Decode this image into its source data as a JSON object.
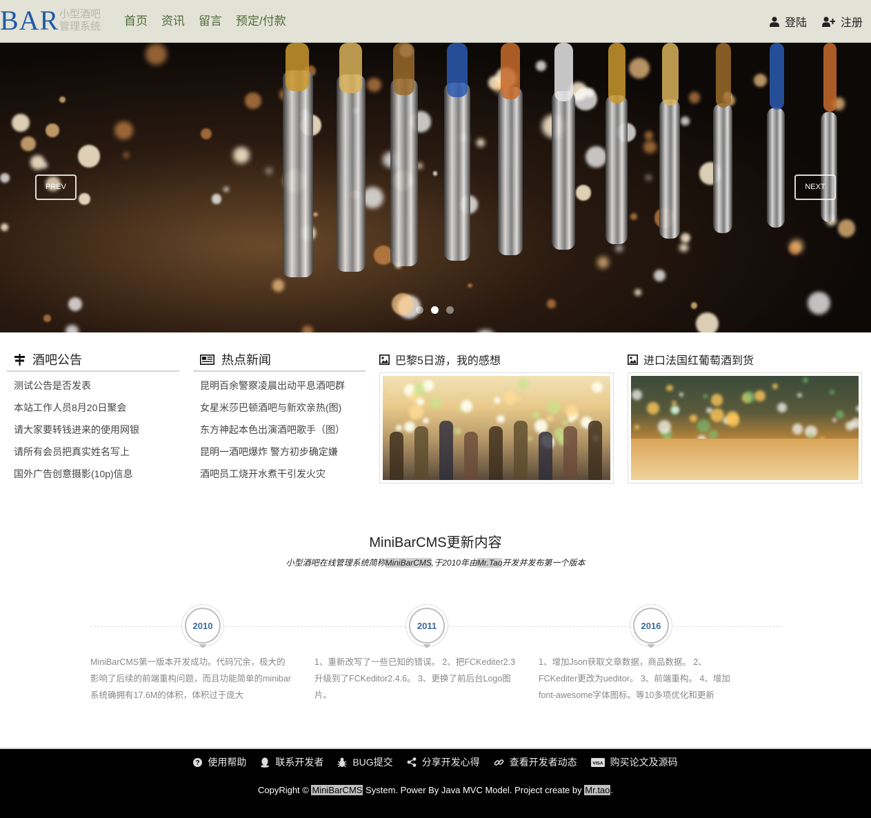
{
  "brand": {
    "name": "BAR",
    "sub_line1": "小型酒吧",
    "sub_line2": "管理系统"
  },
  "nav": {
    "items": [
      "首页",
      "资讯",
      "留言",
      "预定/付款"
    ],
    "login": "登陆",
    "register": "注册"
  },
  "carousel": {
    "prev": "PREV",
    "next": "NEXT",
    "slides": 3,
    "active_slide": 2
  },
  "notices": {
    "title": "酒吧公告",
    "items": [
      "测试公告是否发表",
      "本站工作人员8月20日聚会",
      "请大家要转钱进来的使用网银",
      "请所有会员把真实姓名写上",
      "国外广告创意摄影(10p)信息"
    ]
  },
  "news": {
    "title": "热点新闻",
    "items": [
      "昆明百余警察凌晨出动平息酒吧群",
      "女星米莎巴顿酒吧与新欢亲热(图)",
      "东方神起本色出演酒吧歌手（图）",
      "昆明一酒吧爆炸 警方初步确定嫌",
      "酒吧员工烧开水煮干引发火灾"
    ]
  },
  "features": [
    {
      "title": "巴黎5日游，我的感想"
    },
    {
      "title": "进口法国红葡萄酒到货"
    }
  ],
  "updates": {
    "title": "MiniBarCMS更新内容",
    "subtitle_a": "小型酒吧在线管理系统简称",
    "subtitle_hl1": "MiniBarCMS",
    "subtitle_b": ",于2010年由",
    "subtitle_hl2": "Mr.Tao",
    "subtitle_c": "开发并发布第一个版本",
    "timeline": [
      {
        "year": "2010",
        "text": "MiniBarCMS第一版本开发成功。代码冗余，极大的影响了后续的前端重构问题，而且功能简单的minibar系统确拥有17.6M的体积，体积过于庞大"
      },
      {
        "year": "2011",
        "text": "1、重新改写了一些已知的错误。 2、把FCKediter2.3升级到了FCKeditor2.4.6。 3、更换了前后台Logo图片。"
      },
      {
        "year": "2016",
        "text": "1、增加Json获取文章数据，商品数据。 2、FCKediter更改为ueditor。 3、前端重构。 4、增加font-awesome字体图标。等10多项优化和更新"
      }
    ]
  },
  "footer": {
    "links": [
      "使用帮助",
      "联系开发者",
      "BUG提交",
      "分享开发心得",
      "查看开发者动态",
      "购买论文及源码"
    ],
    "copy_a": "CopyRight ©",
    "copy_hl1": "MiniBarCMS",
    "copy_b": "System. Power By Java MVC Model. Project create by",
    "copy_hl2": "Mr.tao",
    "copy_c": "."
  },
  "colors": {
    "navbar_bg": "#e2e2d6",
    "brand": "#1f5aa6",
    "nav_link": "#4f6b3a",
    "year": "#3b6aa0",
    "footer_bg": "#000000"
  }
}
